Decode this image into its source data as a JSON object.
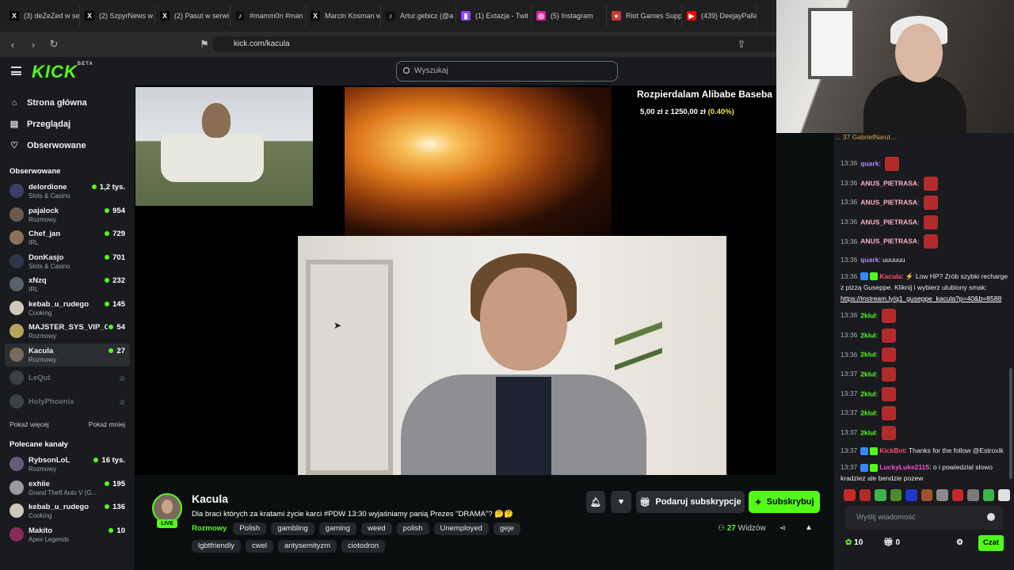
{
  "browser": {
    "tabs": [
      {
        "label": "(3) deZeZed w se",
        "icon": "x-icon"
      },
      {
        "label": "(2) SzpyrNews w",
        "icon": "x-icon"
      },
      {
        "label": "(2) Pasut w serwi",
        "icon": "x-icon"
      },
      {
        "label": "#mamm0n #man",
        "icon": "tiktok-icon"
      },
      {
        "label": "Marcin Kosman w",
        "icon": "x-icon"
      },
      {
        "label": "Artur.gebicz (@a",
        "icon": "tiktok-icon"
      },
      {
        "label": "(1) Extazja - Twit",
        "icon": "twitch-icon"
      },
      {
        "label": "(5) Instagram",
        "icon": "instagram-icon"
      },
      {
        "label": "Riot Games Supp",
        "icon": "riot-icon"
      },
      {
        "label": "(439) DeejayPalla",
        "icon": "youtube-icon"
      }
    ],
    "url": "kick.com/kacula"
  },
  "header": {
    "logo": "KICK",
    "logo_beta": "BETA",
    "search_placeholder": "Wyszukaj"
  },
  "sidebar": {
    "nav": [
      {
        "label": "Strona główna",
        "icon": "home-icon"
      },
      {
        "label": "Przeglądaj",
        "icon": "browse-icon"
      },
      {
        "label": "Obserwowane",
        "icon": "heart-icon"
      }
    ],
    "followed_title": "Obserwowane",
    "followed": [
      {
        "name": "delordione",
        "category": "Slots & Casino",
        "viewers": "1,2 tys.",
        "color": "#3b3f66"
      },
      {
        "name": "pajalock",
        "category": "Rozmowy",
        "viewers": "954",
        "color": "#6b5a4e"
      },
      {
        "name": "Chef_jan",
        "category": "IRL",
        "viewers": "729",
        "color": "#8a7258"
      },
      {
        "name": "DonKasjo",
        "category": "Slots & Casino",
        "viewers": "701",
        "color": "#2f3447"
      },
      {
        "name": "xNzq",
        "category": "IRL",
        "viewers": "232",
        "color": "#58606a"
      },
      {
        "name": "kebab_u_rudego",
        "category": "Cooking",
        "viewers": "145",
        "color": "#d0c8b8"
      },
      {
        "name": "MAJSTER_SYS_VIP_C",
        "category": "Rozmowy",
        "viewers": "54",
        "color": "#b8a35a"
      },
      {
        "name": "Kacula",
        "category": "Rozmowy",
        "viewers": "27",
        "color": "#7a6a5e"
      }
    ],
    "offline": [
      {
        "name": "LeQut",
        "status": "offline"
      },
      {
        "name": "HolyPhoenix",
        "status": "offline"
      }
    ],
    "show_more": "Pokaż więcej",
    "show_less": "Pokaż mniej",
    "recommended_title": "Polecane kanały",
    "recommended": [
      {
        "name": "RybsonLoL",
        "category": "Rozmowy",
        "viewers": "16 tys.",
        "color": "#6a5a7a"
      },
      {
        "name": "exhiie",
        "category": "Grand Theft Auto V (G...",
        "viewers": "195",
        "color": "#9a9a9a"
      },
      {
        "name": "kebab_u_rudego",
        "category": "Cooking",
        "viewers": "136",
        "color": "#d0c8b8"
      },
      {
        "name": "Makito",
        "category": "Apex Legends",
        "viewers": "10",
        "color": "#8a2a5a"
      }
    ]
  },
  "overlay": {
    "goal_title": "Rozpierdalam Alibabe Baseba",
    "goal_amount": "5,00 zł z 1250,00 zł",
    "goal_percent": "(0.40%)"
  },
  "stream_info": {
    "streamer": "Kacula",
    "live_label": "LIVE",
    "title": "Dla braci których za kratami życie karci #PDW 13:30 wyjaśniamy panią Prezes \"DRAMA\"? 🤔🤔",
    "category": "Rozmowy",
    "tags": [
      "Polish",
      "gambling",
      "gaming",
      "weed",
      "polish",
      "Unemployed",
      "geje",
      "lgbtfriendly",
      "cwel",
      "antysemityzm",
      "ciotodron"
    ],
    "gift_label": "Podaruj subskrypcje",
    "subscribe_label": "Subskrybuj",
    "viewers_count": "27",
    "viewers_label": "Widzów"
  },
  "chat": {
    "top_bar": "… 37    GabrielNarut…",
    "messages": [
      {
        "time": "13:36",
        "user": "quark",
        "color": "#b388ff",
        "text": "",
        "emote": true
      },
      {
        "time": "13:36",
        "user": "ANUS_PIETRASA",
        "color": "#ffb3c6",
        "text": "",
        "emote": true
      },
      {
        "time": "13:36",
        "user": "ANUS_PIETRASA",
        "color": "#ffb3c6",
        "text": "",
        "emote": true
      },
      {
        "time": "13:36",
        "user": "ANUS_PIETRASA",
        "color": "#ffb3c6",
        "text": "",
        "emote": true
      },
      {
        "time": "13:36",
        "user": "ANUS_PIETRASA",
        "color": "#ffb3c6",
        "text": "",
        "emote": true
      },
      {
        "time": "13:36",
        "user": "quark",
        "color": "#b388ff",
        "text": "uuuuuu",
        "emote": false
      },
      {
        "time": "13:36",
        "user": "Kacula",
        "color": "#ff4d6d",
        "text": "⚡ Low HP? Zrób szybki recharge z pizzą Guseppe. Kliknij i wybierz ulubiony smak:",
        "link": "https://instream.ly/q1_guseppe_kacula?p=40&b=8588",
        "emote": false
      },
      {
        "time": "13:36",
        "user": "2klul",
        "color": "#53fc18",
        "text": "",
        "emote": true
      },
      {
        "time": "13:36",
        "user": "2klul",
        "color": "#53fc18",
        "text": "",
        "emote": true
      },
      {
        "time": "13:36",
        "user": "2klul",
        "color": "#53fc18",
        "text": "",
        "emote": true
      },
      {
        "time": "13:37",
        "user": "2klul",
        "color": "#53fc18",
        "text": "",
        "emote": true
      },
      {
        "time": "13:37",
        "user": "2klul",
        "color": "#53fc18",
        "text": "",
        "emote": true
      },
      {
        "time": "13:37",
        "user": "2klul",
        "color": "#53fc18",
        "text": "",
        "emote": true
      },
      {
        "time": "13:37",
        "user": "2klul",
        "color": "#53fc18",
        "text": "",
        "emote": true
      },
      {
        "time": "13:37",
        "user": "KickBot",
        "color": "#ff4d6d",
        "text": "Thanks for the follow @Estroxik",
        "emote": false
      },
      {
        "time": "13:37",
        "user": "LuckyLuke2115",
        "color": "#ff4fd8",
        "text": "o i powiedzial slowo kradziez ale bendzie pozew",
        "emote": false
      }
    ],
    "input_placeholder": "Wyślij wiadomość",
    "points": "10",
    "gifts": "0",
    "send_label": "Czat"
  }
}
